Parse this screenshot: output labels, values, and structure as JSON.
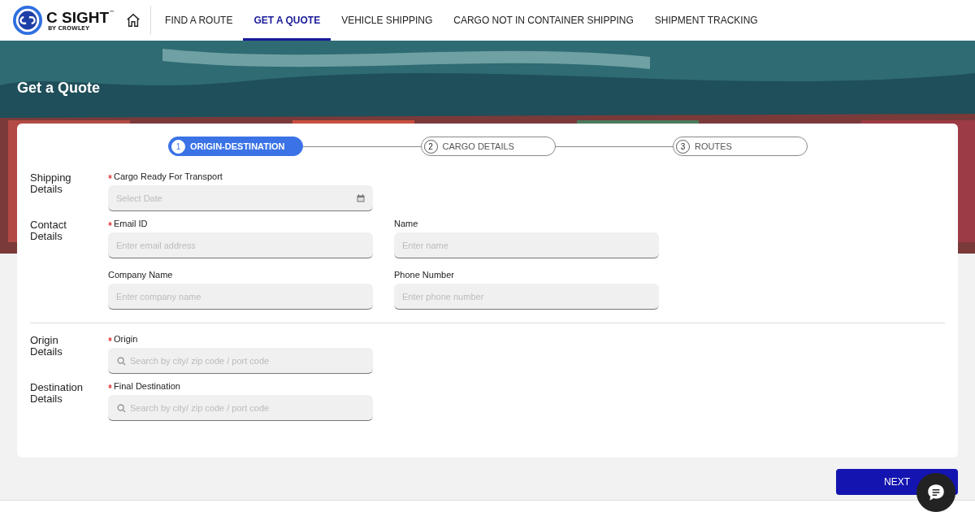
{
  "header": {
    "logo": {
      "name": "C SIGHT",
      "mark": "™",
      "tagline": "BY CROWLEY"
    },
    "nav": [
      {
        "label": "FIND A ROUTE",
        "selected": false
      },
      {
        "label": "GET A QUOTE",
        "selected": true
      },
      {
        "label": "VEHICLE SHIPPING",
        "selected": false
      },
      {
        "label": "CARGO NOT IN CONTAINER SHIPPING",
        "selected": false
      },
      {
        "label": "SHIPMENT TRACKING",
        "selected": false
      }
    ]
  },
  "hero": {
    "title": "Get a Quote",
    "kind": "picture"
  },
  "stepper": [
    {
      "number": "1",
      "label": "ORIGIN-DESTINATION",
      "selected": true
    },
    {
      "number": "2",
      "label": "CARGO DETAILS",
      "selected": false
    },
    {
      "number": "3",
      "label": "ROUTES",
      "selected": false
    }
  ],
  "groups": [
    [
      {
        "title": "Shipping Details",
        "fields": [
          {
            "label": "Cargo Ready For Transport",
            "required": true,
            "placeholder": "Select Date",
            "kind": "date"
          }
        ]
      },
      {
        "title": "Contact Details",
        "fields": [
          {
            "label": "Email ID",
            "required": true,
            "placeholder": "Enter email address",
            "kind": "text"
          },
          {
            "label": "Name",
            "required": false,
            "placeholder": "Enter name",
            "kind": "text"
          },
          {
            "label": "Company Name",
            "required": false,
            "placeholder": "Enter company name",
            "kind": "text"
          },
          {
            "label": "Phone Number",
            "required": false,
            "placeholder": "Enter phone number",
            "kind": "text"
          }
        ]
      }
    ],
    [
      {
        "title": "Origin Details",
        "fields": [
          {
            "label": "Origin",
            "required": true,
            "placeholder": "Search by city/ zip code / port code",
            "kind": "search"
          }
        ]
      },
      {
        "title": "Destination Details",
        "fields": [
          {
            "label": "Final Destination",
            "required": true,
            "placeholder": "Search by city/ zip code / port code",
            "kind": "search"
          }
        ]
      }
    ]
  ],
  "next_button": "NEXT"
}
